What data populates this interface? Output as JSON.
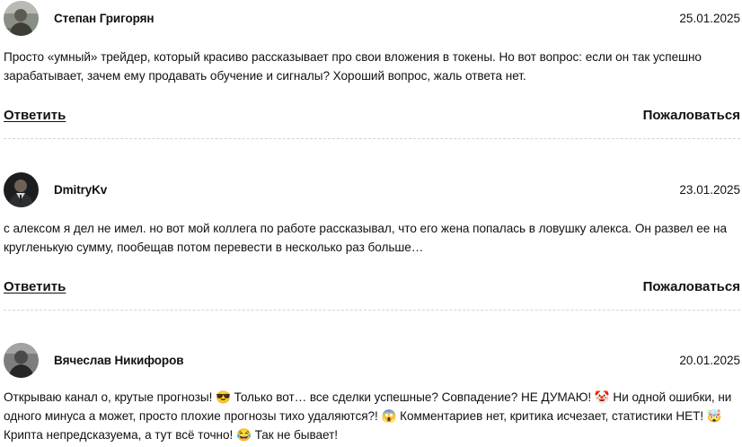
{
  "comments": [
    {
      "author": "Степан Григорян",
      "date": "25.01.2025",
      "avatar_icon": "avatar-photo-icon",
      "text": "Просто «умный» трейдер, который красиво рассказывает про свои вложения в токены. Но вот вопрос: если он так успешно зарабатывает, зачем ему продавать обучение и сигналы? Хороший вопрос, жаль ответа нет.",
      "reply_label": "Ответить",
      "report_label": "Пожаловаться"
    },
    {
      "author": "DmitryKv",
      "date": "23.01.2025",
      "avatar_icon": "avatar-photo-icon",
      "text": "с алексом я дел не имел. но вот мой коллега по работе рассказывал, что его жена попалась в ловушку алекса. Он развел ее на кругленькую сумму, пообещав потом перевести в несколько раз больше…",
      "reply_label": "Ответить",
      "report_label": "Пожаловаться"
    },
    {
      "author": "Вячеслав Никифоров",
      "date": "20.01.2025",
      "avatar_icon": "avatar-photo-icon",
      "text": "Открываю канал о, крутые прогнозы! 😎 Только вот… все сделки успешные? Совпадение? НЕ ДУМАЮ! 🤡 Ни одной ошибки, ни одного минуса а может, просто плохие прогнозы тихо удаляются?! 😱 Комментариев нет, критика исчезает, статистики НЕТ! 🤯 Крипта непредсказуема, а тут всё точно! 😂 Так не бывает!"
    }
  ]
}
